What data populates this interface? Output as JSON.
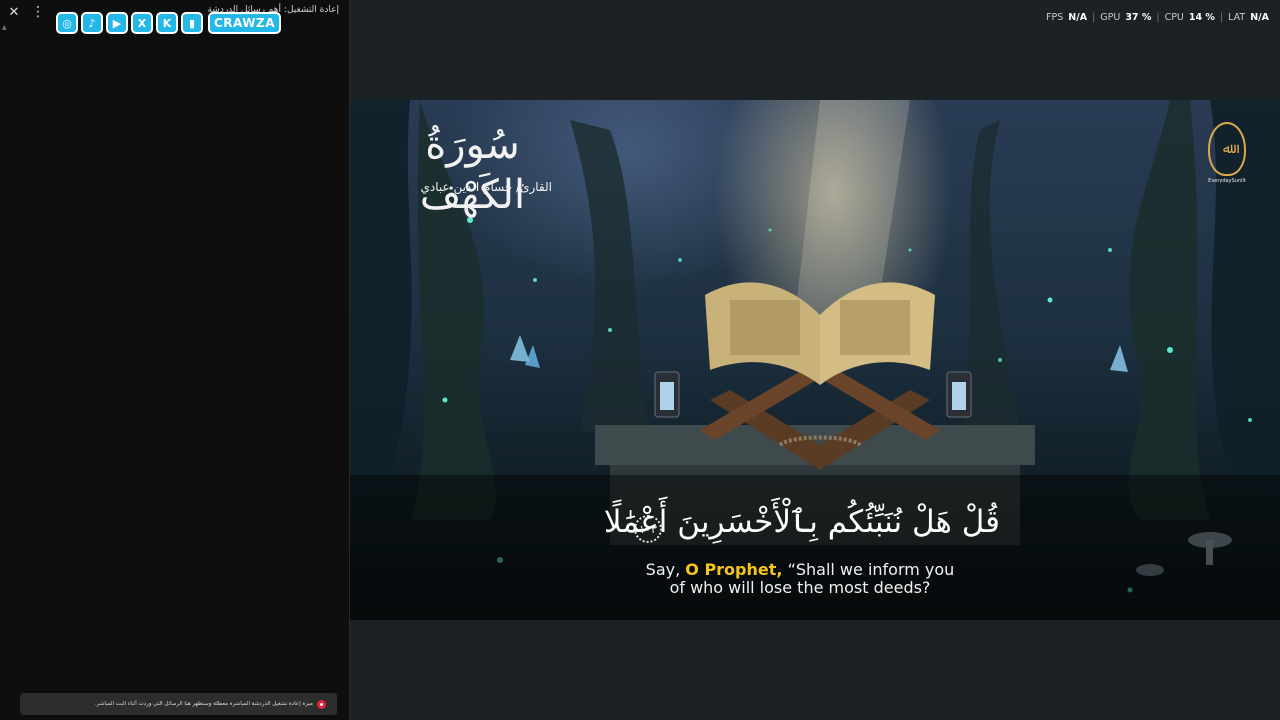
{
  "chat": {
    "title": "إعادة التشغيل: أهم رسائل الدردشة",
    "close_label": "✕",
    "menu_label": "⋮",
    "scroll_arrow": "▲",
    "social": {
      "icons": [
        "instagram-icon",
        "tiktok-icon",
        "youtube-icon",
        "x-icon",
        "kick-icon",
        "twitch-icon"
      ],
      "icon_glyphs": [
        "◎",
        "♪",
        "▶",
        "X",
        "K",
        "▮"
      ],
      "brand": "CRAWZA",
      "accent": "#23b8e8"
    },
    "banner": {
      "text": "ميزة إعادة تشغيل الدردشة المباشرة معطلة وستظهر هنا الرسائل التي وردت أثناء البث المباشر.",
      "icon": "live-dot-icon",
      "color": "#e0253a"
    }
  },
  "stats": {
    "fps_label": "FPS",
    "fps_value": "N/A",
    "gpu_label": "GPU",
    "gpu_value": "37 %",
    "cpu_label": "CPU",
    "cpu_value": "14 %",
    "lat_label": "LAT",
    "lat_value": "N/A",
    "separator": "|"
  },
  "video": {
    "surah_title": "سُورَةُ الكَهْف",
    "reciter": "القارئ/ حسام الدين عبادي",
    "logo_glyph": "ﷲ",
    "logo_text": "EverydaySunlit",
    "verse_arabic": "قُلْ هَلْ نُنَبِّئُكُم بِٱلْأَخْسَرِينَ أَعْمَٰلًا",
    "verse_number": "١٠٣",
    "verse_en_1": "Say,",
    "verse_en_hl": "O Prophet,",
    "verse_en_2": "“Shall we inform you",
    "verse_en_line2": "of who will lose the most deeds?",
    "highlight_color": "#f5c518"
  }
}
